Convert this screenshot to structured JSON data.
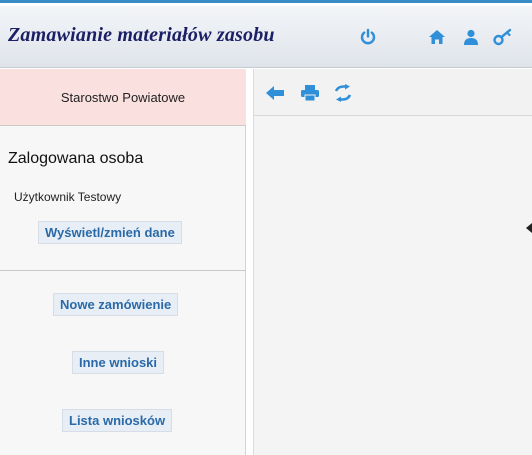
{
  "header": {
    "title": "Zamawianie materiałów zasobu",
    "icons": {
      "power": "power-icon",
      "home": "home-icon",
      "user": "user-icon",
      "key": "key-icon"
    }
  },
  "sidebar": {
    "organization": "Starostwo Powiatowe",
    "logged_heading": "Zalogowana osoba",
    "user_name": "Użytkownik Testowy",
    "view_data_button": "Wyświetl/zmień dane",
    "new_order_button": "Nowe zamówienie",
    "other_requests_button": "Inne wnioski",
    "requests_list_button": "Lista wniosków"
  },
  "toolbar": {
    "icons": [
      "back-arrow-icon",
      "print-icon",
      "refresh-icon"
    ]
  },
  "colors": {
    "accent": "#3a8cc8",
    "title": "#1b1f66",
    "link": "#2a6aa8",
    "org_box": "#fbe0e0"
  }
}
